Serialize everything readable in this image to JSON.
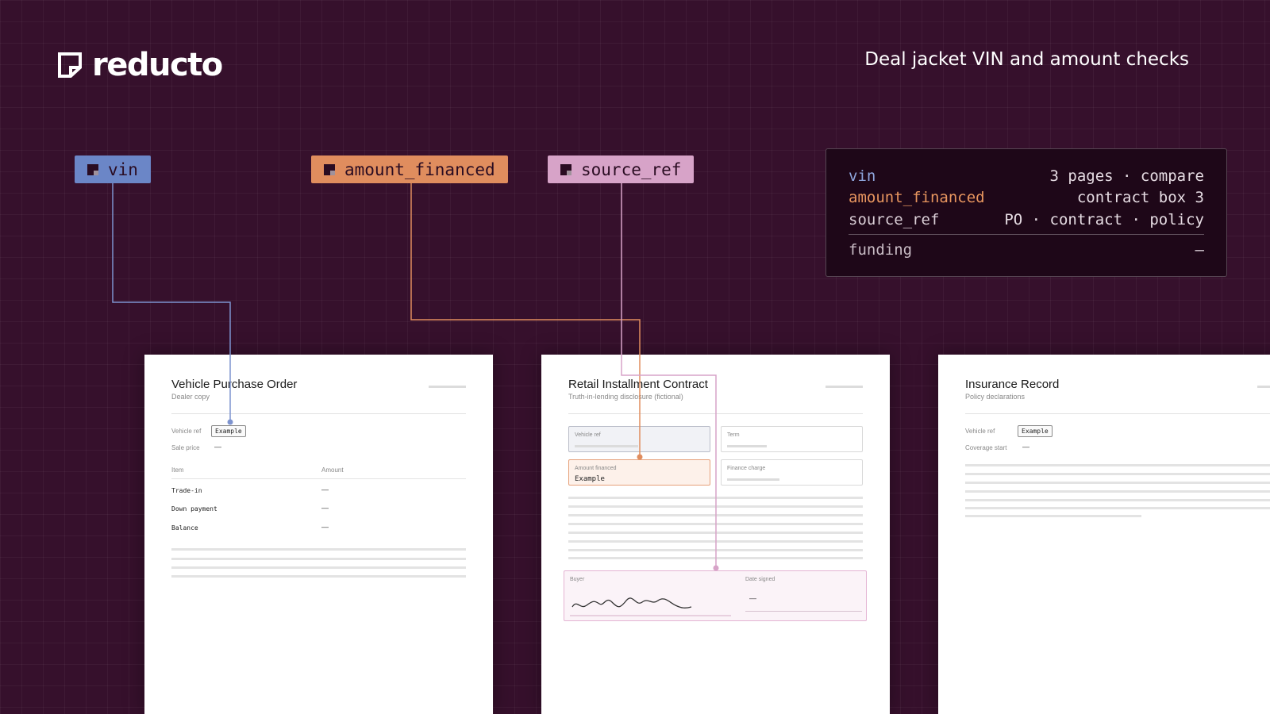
{
  "brand": {
    "name": "reducto"
  },
  "header": {
    "title": "Deal jacket VIN and amount checks"
  },
  "chips": [
    {
      "label": "vin",
      "color": "#6b86c7"
    },
    {
      "label": "amount_financed",
      "color": "#e08d5e"
    },
    {
      "label": "source_ref",
      "color": "#d7a3c8"
    }
  ],
  "summary": {
    "rows": [
      {
        "key": "vin",
        "value": "3 pages · compare",
        "color": "#8fa6dd"
      },
      {
        "key": "amount_financed",
        "value": "contract box 3",
        "color": "#e8965f"
      },
      {
        "key": "source_ref",
        "value": "PO · contract · policy",
        "color": "#d9cdd5"
      }
    ],
    "footer": {
      "key": "funding",
      "value": "—"
    }
  },
  "documents": {
    "purchase_order": {
      "title": "Vehicle Purchase Order",
      "subtitle": "Dealer copy",
      "vehicle_ref_label": "Vehicle ref",
      "vehicle_ref_value": "Example",
      "sale_price_label": "Sale price",
      "sale_price_value": "—",
      "table": {
        "headers": [
          "Item",
          "Amount"
        ],
        "rows": [
          [
            "Trade-in",
            "—"
          ],
          [
            "Down payment",
            "—"
          ],
          [
            "Balance",
            "—"
          ]
        ]
      }
    },
    "installment_contract": {
      "title": "Retail Installment Contract",
      "subtitle": "Truth-in-lending disclosure (fictional)",
      "boxes": {
        "vehicle_ref": "Vehicle ref",
        "term": "Term",
        "amount_financed": "Amount financed",
        "amount_financed_value": "Example",
        "finance_charge": "Finance charge"
      },
      "signature": {
        "buyer_label": "Buyer",
        "date_label": "Date signed",
        "date_value": "—"
      }
    },
    "insurance_record": {
      "title": "Insurance Record",
      "subtitle": "Policy declarations",
      "vehicle_ref_label": "Vehicle ref",
      "vehicle_ref_value": "Example",
      "coverage_start_label": "Coverage start",
      "coverage_start_value": "—"
    }
  }
}
